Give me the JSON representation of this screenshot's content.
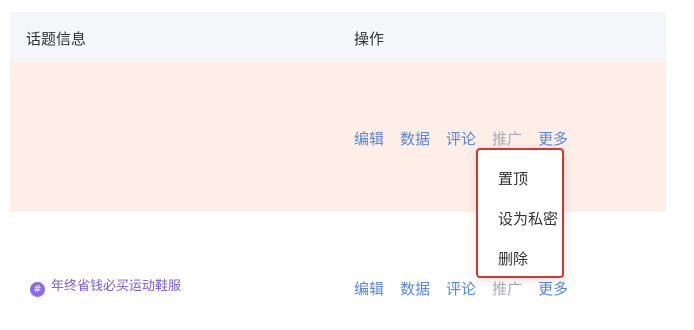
{
  "table": {
    "headers": {
      "topic_info": "话题信息",
      "actions": "操作"
    },
    "rows": [
      {
        "topic": "",
        "actions": {
          "edit": "编辑",
          "data": "数据",
          "comment": "评论",
          "promote": "推广",
          "more": "更多"
        }
      },
      {
        "topic": "年终省钱必买运动鞋服",
        "topic_icon": "hash-icon",
        "actions": {
          "edit": "编辑",
          "data": "数据",
          "comment": "评论",
          "promote": "推广",
          "more": "更多"
        }
      }
    ]
  },
  "more_menu": {
    "items": [
      "置顶",
      "设为私密",
      "删除"
    ],
    "highlight_color": "#d8342f"
  },
  "colors": {
    "link": "#5b87d9",
    "disabled": "#a9acb2",
    "row_highlight": "#fdeee8",
    "topic": "#7b5ad4"
  }
}
